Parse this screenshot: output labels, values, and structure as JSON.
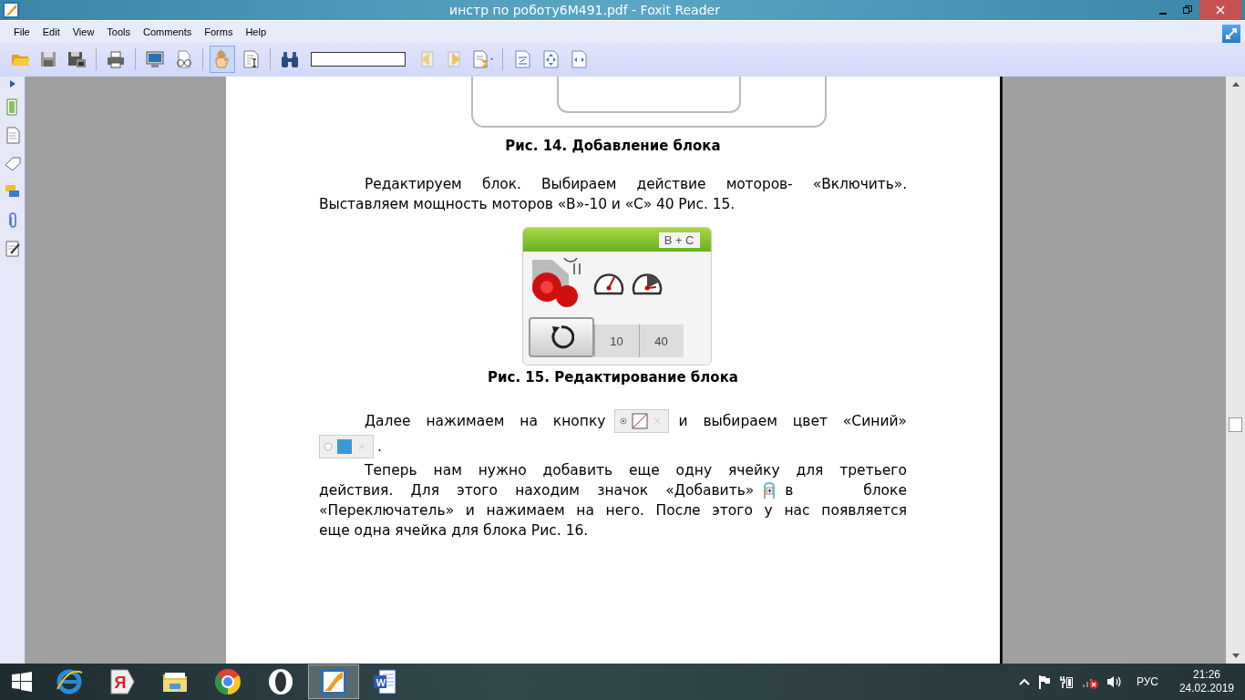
{
  "window": {
    "title": "инстр по роботу6М491.pdf - Foxit Reader"
  },
  "menu": [
    "File",
    "Edit",
    "View",
    "Tools",
    "Comments",
    "Forms",
    "Help"
  ],
  "toolbar": {
    "groups": [
      [
        {
          "kind": "open",
          "selected": false
        },
        {
          "kind": "save",
          "selected": false
        },
        {
          "kind": "saveas",
          "selected": false
        }
      ],
      [
        {
          "kind": "print",
          "selected": false
        }
      ],
      [
        {
          "kind": "monitor",
          "selected": false
        },
        {
          "kind": "glasses",
          "selected": false
        }
      ],
      [
        {
          "kind": "hand",
          "selected": true
        },
        {
          "kind": "textselect",
          "selected": false
        }
      ],
      [
        {
          "kind": "binoculars",
          "selected": false
        },
        {
          "kind": "field",
          "selected": false
        },
        {
          "kind": "prev",
          "selected": false
        },
        {
          "kind": "next",
          "selected": false
        },
        {
          "kind": "findopts",
          "selected": false
        }
      ],
      [
        {
          "kind": "zoom",
          "selected": false
        },
        {
          "kind": "fitpage",
          "selected": false
        },
        {
          "kind": "fitwidth",
          "selected": false
        }
      ]
    ]
  },
  "sidebar": {
    "items": [
      {
        "kind": "pages"
      },
      {
        "kind": "page"
      },
      {
        "kind": "tag"
      },
      {
        "kind": "comment"
      },
      {
        "kind": "clip"
      },
      {
        "kind": "sign"
      }
    ]
  },
  "document": {
    "figure_14": {
      "caption": "Рис. 14. Добавление блока"
    },
    "paragraph_1": "Редактируем блок. Выбираем действие моторов- «Включить». Выставляем мощность моторов «В»-10 и «С» 40 Рис. 15.",
    "figure_15": {
      "port": "B + C",
      "values": [
        "10",
        "40"
      ],
      "caption": "Рис. 15. Редактирование блока"
    },
    "paragraph_2": {
      "lines": [
        [
          {
            "text": "Далее нажимаем на кнопку"
          },
          {
            "kind": "sensor-button"
          },
          {
            "text": "и выбираем цвет «Синий»"
          }
        ],
        [
          {
            "kind": "color-button"
          },
          {
            "text": "."
          }
        ]
      ]
    },
    "paragraph_3": {
      "lines": [
        [
          {
            "text": "Теперь нам нужно добавить еще одну ячейку для третьего"
          }
        ],
        [
          {
            "text": "действия. Для этого находим значок «Добавить»"
          },
          {
            "kind": "add-icon"
          },
          {
            "text": "в блоке"
          }
        ],
        [
          {
            "text": "«Переключатель» и нажимаем на него. После этого у нас появляется"
          }
        ],
        [
          {
            "text": "еще одна ячейка для блока Рис. 16."
          }
        ]
      ]
    }
  },
  "taskbar": {
    "items": [
      {
        "kind": "ie",
        "selected": false
      },
      {
        "kind": "yandex",
        "label": "Я",
        "selected": false
      },
      {
        "kind": "explorer",
        "selected": false
      },
      {
        "kind": "chrome",
        "selected": false
      },
      {
        "kind": "opera",
        "selected": false
      },
      {
        "kind": "foxit",
        "selected": true
      },
      {
        "kind": "word",
        "label": "W",
        "selected": false
      }
    ],
    "language": "РУС",
    "time": "21:26",
    "date": "24.02.2019"
  }
}
